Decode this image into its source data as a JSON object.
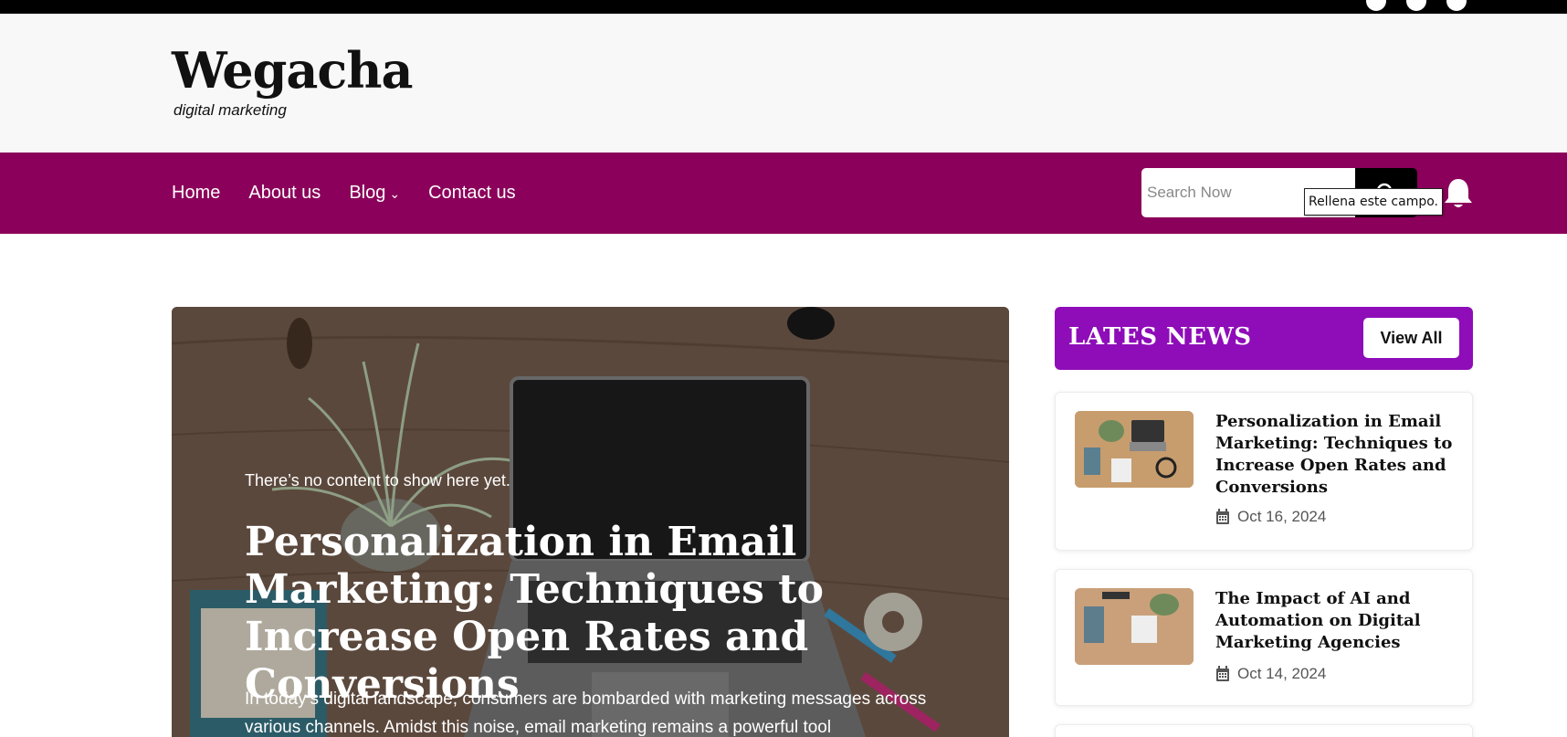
{
  "header": {
    "logo": "Wegacha",
    "tagline": "digital marketing"
  },
  "nav": {
    "items": [
      {
        "label": "Home"
      },
      {
        "label": "About us"
      },
      {
        "label": "Blog"
      },
      {
        "label": "Contact us"
      }
    ],
    "search_placeholder": "Search Now",
    "tooltip": "Rellena este campo."
  },
  "hero": {
    "notice": "There’s no content to show here yet.",
    "title": "Personalization in Email Marketing: Techniques to Increase Open Rates and Conversions",
    "excerpt": "In today’s digital landscape, consumers are bombarded with marketing messages across various channels. Amidst this noise, email marketing remains a powerful tool"
  },
  "sidebar": {
    "heading": "LATES NEWS",
    "view_all": "View All",
    "posts": [
      {
        "title": "Personalization in Email Marketing: Techniques to Increase Open Rates and Conversions",
        "date": "Oct 16, 2024"
      },
      {
        "title": "The Impact of AI and Automation on Digital Marketing Agencies",
        "date": "Oct 14, 2024"
      }
    ]
  },
  "colors": {
    "nav_bg": "#8b005a",
    "sidebar_header_bg": "#8e0db8",
    "header_bg": "#f8f8f8"
  },
  "icons": [
    "search-icon",
    "bell-icon",
    "calendar-icon",
    "chevron-down-icon"
  ]
}
